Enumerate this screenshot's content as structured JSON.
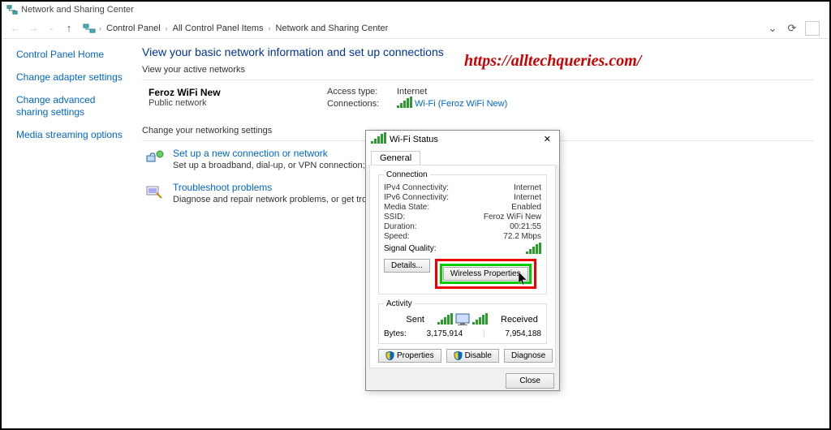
{
  "window_title": "Network and Sharing Center",
  "breadcrumb": {
    "items": [
      "Control Panel",
      "All Control Panel Items",
      "Network and Sharing Center"
    ]
  },
  "sidebar": {
    "home": "Control Panel Home",
    "links": [
      "Change adapter settings",
      "Change advanced sharing settings",
      "Media streaming options"
    ]
  },
  "main": {
    "title": "View your basic network information and set up connections",
    "active_label": "View your active networks",
    "network": {
      "name": "Feroz WiFi New",
      "type": "Public network",
      "access_label": "Access type:",
      "access_value": "Internet",
      "conn_label": "Connections:",
      "conn_value": "Wi-Fi (Feroz WiFi New)"
    },
    "change_label": "Change your networking settings",
    "actions": [
      {
        "title": "Set up a new connection or network",
        "desc": "Set up a broadband, dial-up, or VPN connection; or set up a r"
      },
      {
        "title": "Troubleshoot problems",
        "desc": "Diagnose and repair network problems, or get troubleshootin"
      }
    ]
  },
  "watermark": "https://alltechqueries.com/",
  "dialog": {
    "title": "Wi-Fi Status",
    "tab": "General",
    "conn_group": "Connection",
    "rows": {
      "ipv4_l": "IPv4 Connectivity:",
      "ipv4_v": "Internet",
      "ipv6_l": "IPv6 Connectivity:",
      "ipv6_v": "Internet",
      "media_l": "Media State:",
      "media_v": "Enabled",
      "ssid_l": "SSID:",
      "ssid_v": "Feroz WiFi New",
      "dur_l": "Duration:",
      "dur_v": "00:21:55",
      "speed_l": "Speed:",
      "speed_v": "72.2 Mbps",
      "signal_l": "Signal Quality:"
    },
    "btn_details": "Details...",
    "btn_wprops": "Wireless Properties",
    "activity_group": "Activity",
    "sent": "Sent",
    "received": "Received",
    "bytes_l": "Bytes:",
    "bytes_sent": "3,175,914",
    "bytes_recv": "7,954,188",
    "btn_props": "Properties",
    "btn_disable": "Disable",
    "btn_diag": "Diagnose",
    "btn_close": "Close"
  }
}
